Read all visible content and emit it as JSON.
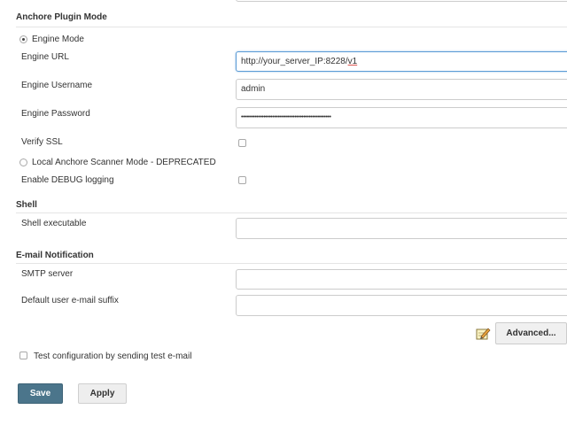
{
  "anchore_section": {
    "title": "Anchore Plugin Mode",
    "engine_mode_label": "Engine Mode",
    "engine_url_label": "Engine URL",
    "engine_url_value_prefix": "http://your_server_IP:8228/",
    "engine_url_value_suffix": "v1",
    "engine_username_label": "Engine Username",
    "engine_username_value": "admin",
    "engine_password_label": "Engine Password",
    "engine_password_value": "••••••••••••••••••••••••••••••••••••••••••••••••••••",
    "verify_ssl_label": "Verify SSL",
    "local_mode_label": "Local Anchore Scanner Mode - DEPRECATED",
    "debug_label": "Enable DEBUG logging"
  },
  "shell_section": {
    "title": "Shell",
    "executable_label": "Shell executable",
    "executable_value": ""
  },
  "email_section": {
    "title": "E-mail Notification",
    "smtp_label": "SMTP server",
    "smtp_value": "",
    "suffix_label": "Default user e-mail suffix",
    "suffix_value": "",
    "advanced_label": "Advanced...",
    "test_label": "Test configuration by sending test e-mail"
  },
  "footer": {
    "save_label": "Save",
    "apply_label": "Apply"
  },
  "colors": {
    "save_bg": "#4b758b",
    "focus_border": "#5b9bd5"
  },
  "icons": {
    "advanced": "notepad-pencil-icon"
  }
}
